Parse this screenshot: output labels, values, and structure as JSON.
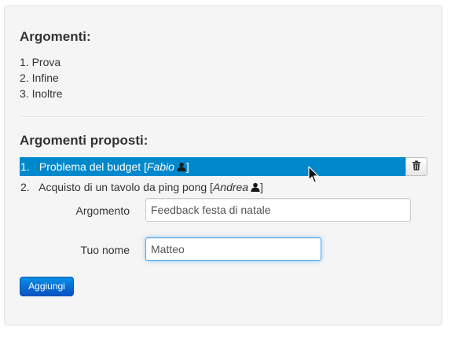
{
  "arguments": {
    "title": "Argomenti:",
    "items": [
      "1. Prova",
      "2. Infine",
      "3. Inoltre"
    ]
  },
  "proposed": {
    "title": "Argomenti proposti:",
    "items": [
      {
        "num": "1.",
        "text": "Problema del budget [",
        "author": "Fabio",
        "close": "]",
        "selected": true
      },
      {
        "num": "2.",
        "text": "Acquisto di un tavolo da ping pong [",
        "author": "Andrea",
        "close": "]",
        "selected": false
      }
    ]
  },
  "form": {
    "topic_label": "Argomento",
    "topic_value": "Feedback festa di natale",
    "name_label": "Tuo nome",
    "name_value": "Matteo",
    "submit_label": "Aggiungi"
  },
  "icons": {
    "delete": "trash-icon",
    "author": "user-icon",
    "pointer": "mouse-cursor-icon"
  },
  "colors": {
    "selection": "#0088cc",
    "primary_button": "#0a6fd6",
    "focus_border": "#52a8ec"
  }
}
